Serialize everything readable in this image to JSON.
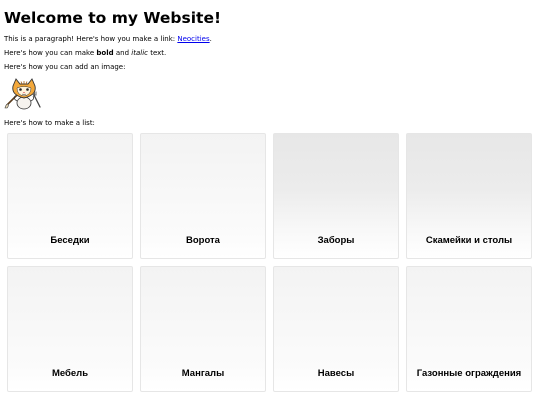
{
  "heading": "Welcome to my Website!",
  "para1": {
    "before": "This is a paragraph! Here's how you make a link: ",
    "link": "Neocities",
    "after": "."
  },
  "para2": {
    "before": "Here's how you can make ",
    "bold": "bold",
    "middle": " and ",
    "italic": "italic",
    "after": " text."
  },
  "para3": "Here's how you can add an image:",
  "para4": "Here's how to make a list:",
  "image": {
    "icon": "neocities-cat-icon"
  },
  "cards": [
    {
      "label": "Беседки"
    },
    {
      "label": "Ворота"
    },
    {
      "label": "Заборы"
    },
    {
      "label": "Скамейки и столы"
    },
    {
      "label": "Мебель"
    },
    {
      "label": "Мангалы"
    },
    {
      "label": "Навесы"
    },
    {
      "label": "Газонные ограждения"
    }
  ]
}
